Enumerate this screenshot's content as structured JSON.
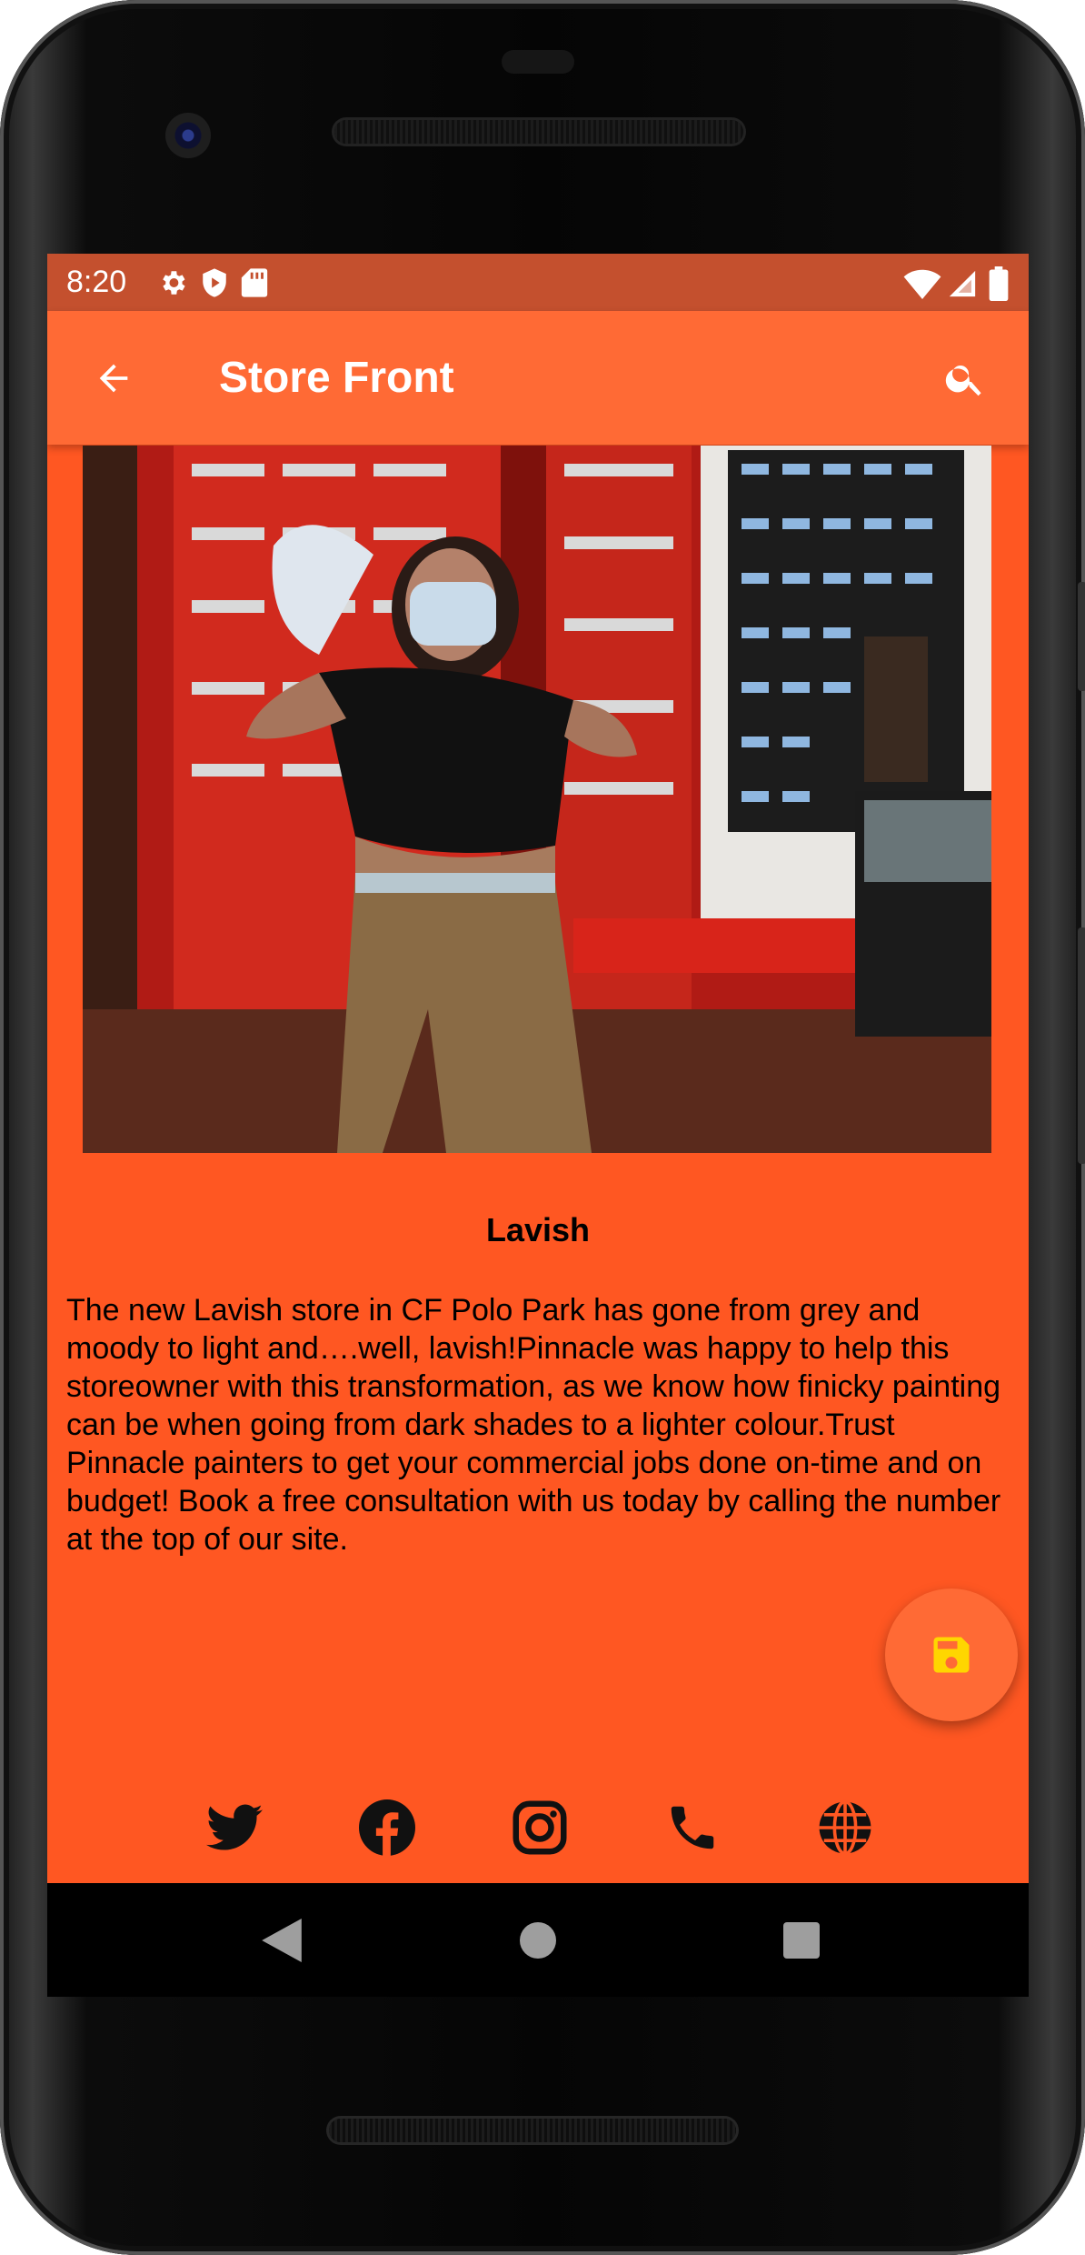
{
  "status_bar": {
    "time": "8:20",
    "left_icons": [
      "settings-icon",
      "shield-play-icon",
      "sd-card-icon"
    ],
    "right_icons": [
      "wifi-icon",
      "signal-icon",
      "battery-icon"
    ]
  },
  "app_bar": {
    "title": "Store Front",
    "back_icon": "arrow-back-icon",
    "search_icon": "search-icon"
  },
  "store": {
    "image_alt": "",
    "name": "Lavish",
    "description": "The new Lavish store in CF Polo Park has gone from grey and moody to light and….well, lavish!Pinnacle was happy to help this storeowner with this transformation, as we know how finicky painting can be when going from dark shades to a lighter colour.Trust Pinnacle painters to get your commercial jobs done on-time and on budget! Book a free consultation with us today by calling the number at the top of our site."
  },
  "fab": {
    "icon": "save-icon"
  },
  "social_links": [
    "twitter-icon",
    "facebook-icon",
    "instagram-icon",
    "phone-icon",
    "globe-icon"
  ],
  "nav_bar": [
    "back-triangle-icon",
    "home-circle-icon",
    "recents-square-icon"
  ],
  "colors": {
    "primary": "#FF5722",
    "app_bar": "#FF6A35",
    "status_bar": "#C4502E",
    "fab_icon": "#FFD600"
  }
}
